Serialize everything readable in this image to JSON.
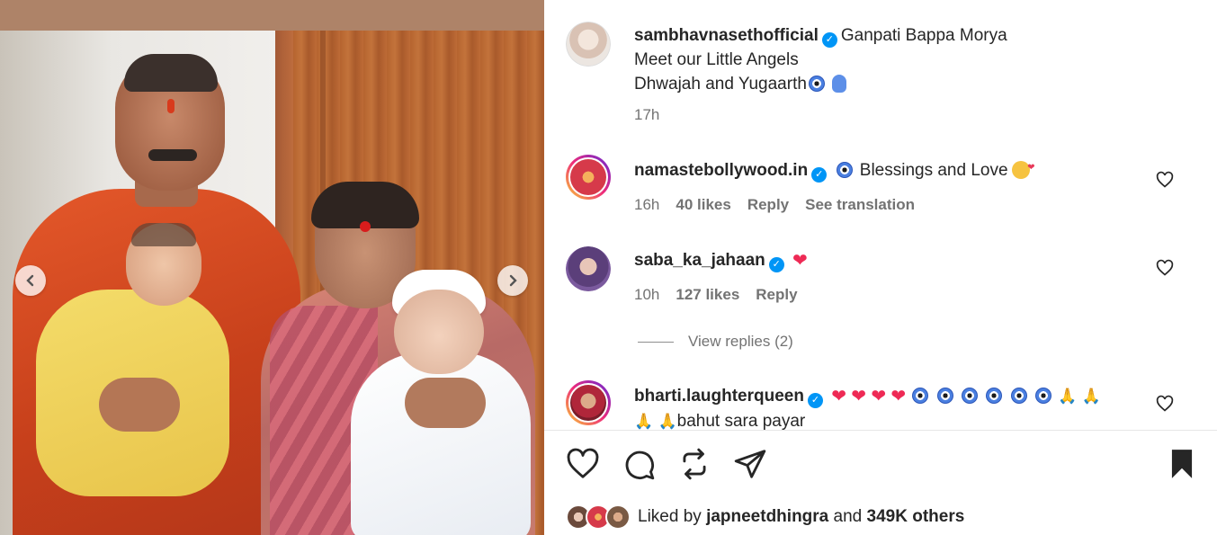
{
  "post": {
    "author": "sambhavnasethofficial",
    "caption_line1": "Ganpati Bappa Morya",
    "caption_line2": "Meet our Little Angels",
    "caption_line3": "Dhwajah and Yugaarth",
    "time": "17h"
  },
  "comments": [
    {
      "username": "namastebollywood.in",
      "text": "Blessings and Love",
      "time": "16h",
      "likes": "40 likes",
      "reply": "Reply",
      "translate": "See translation"
    },
    {
      "username": "saba_ka_jahaan",
      "time": "10h",
      "likes": "127 likes",
      "reply": "Reply",
      "view_replies": "View replies (2)"
    },
    {
      "username": "bharti.laughterqueen",
      "text": "bahut sara payar"
    }
  ],
  "likes": {
    "prefix": "Liked by",
    "user": "japneetdhingra",
    "middle": "and",
    "count": "349K others"
  },
  "colors": {
    "verified": "#0095f6",
    "text": "#262626",
    "muted": "#737373"
  },
  "icons": [
    "verified-badge-icon",
    "heart-icon",
    "comment-icon",
    "share-icon",
    "send-icon",
    "bookmark-icon",
    "chevron-left-icon",
    "chevron-right-icon"
  ]
}
